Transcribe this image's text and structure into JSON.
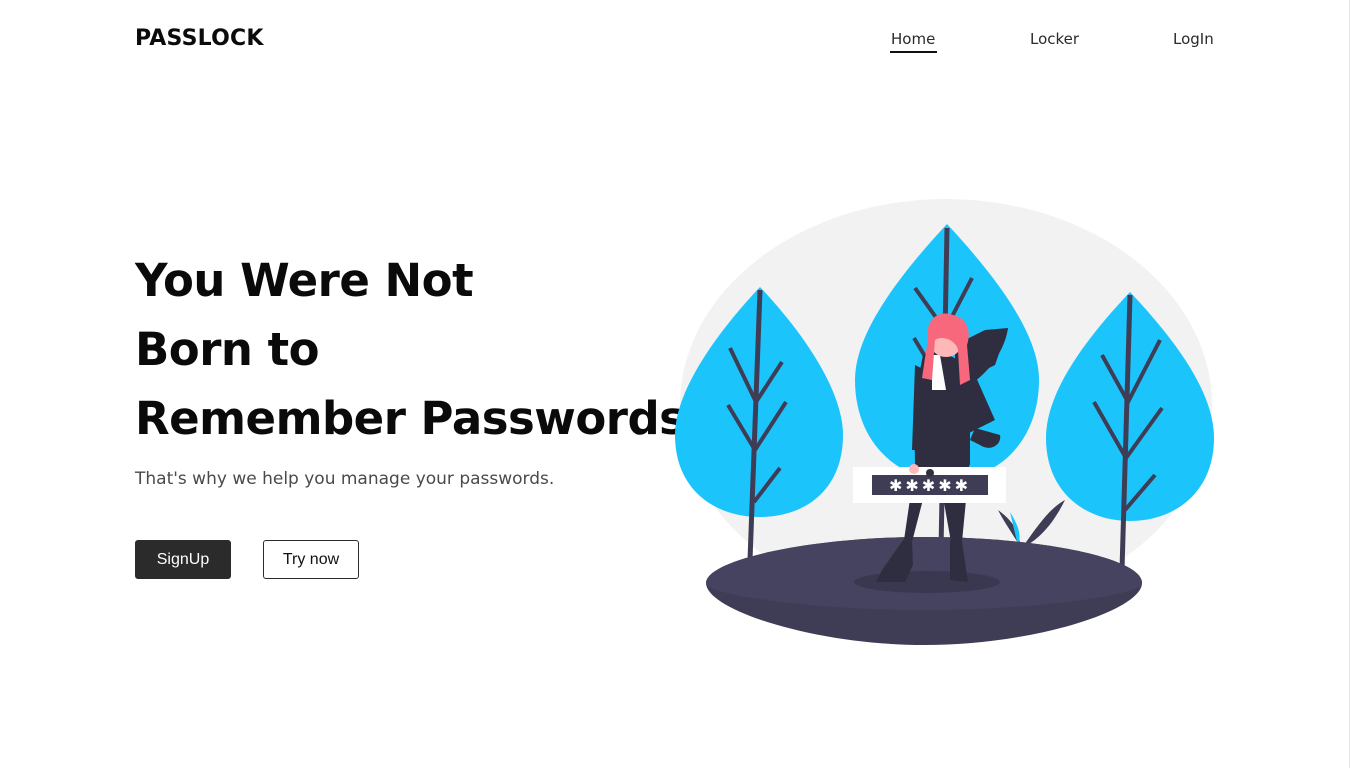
{
  "brand": {
    "name": "PASSLOCK"
  },
  "nav": {
    "items": [
      {
        "label": "Home",
        "active": true
      },
      {
        "label": "Locker",
        "active": false
      },
      {
        "label": "LogIn",
        "active": false
      }
    ]
  },
  "hero": {
    "title_lines": [
      "You Were Not",
      "Born to",
      "Remember Passwords."
    ],
    "subtitle": "That's why we help you manage your passwords.",
    "primary_button": "SignUp",
    "secondary_button": "Try now"
  },
  "illustration": {
    "password_mask": "✱✱✱✱✱",
    "colors": {
      "leaf": "#1cc4fc",
      "ground": "#3f3d56",
      "hair": "#f7687d",
      "backdrop": "#f2f2f2"
    }
  }
}
